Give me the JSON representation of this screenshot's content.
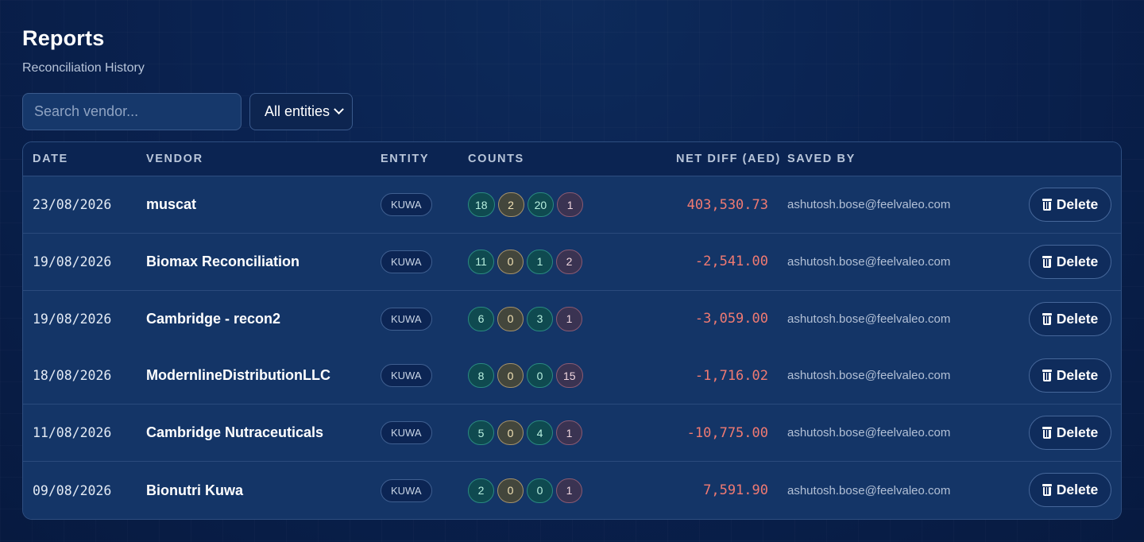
{
  "header": {
    "title": "Reports",
    "subtitle": "Reconciliation History"
  },
  "filters": {
    "search_placeholder": "Search vendor...",
    "entity_select_value": "All entities"
  },
  "table": {
    "columns": [
      "DATE",
      "VENDOR",
      "ENTITY",
      "COUNTS",
      "NET DIFF (AED)",
      "SAVED BY"
    ],
    "delete_label": "Delete",
    "rows": [
      {
        "date": "23/08/2026",
        "vendor": "muscat",
        "entity": "KUWA",
        "counts": [
          "18",
          "2",
          "20",
          "1"
        ],
        "net_diff": "403,530.73",
        "saved_by": "ashutosh.bose@feelvaleo.com"
      },
      {
        "date": "19/08/2026",
        "vendor": "Biomax Reconciliation",
        "entity": "KUWA",
        "counts": [
          "11",
          "0",
          "1",
          "2"
        ],
        "net_diff": "-2,541.00",
        "saved_by": "ashutosh.bose@feelvaleo.com"
      },
      {
        "date": "19/08/2026",
        "vendor": "Cambridge - recon2",
        "entity": "KUWA",
        "counts": [
          "6",
          "0",
          "3",
          "1"
        ],
        "net_diff": "-3,059.00",
        "saved_by": "ashutosh.bose@feelvaleo.com"
      },
      {
        "date": "18/08/2026",
        "vendor": "ModernlineDistributionLLC",
        "entity": "KUWA",
        "counts": [
          "8",
          "0",
          "0",
          "15"
        ],
        "net_diff": "-1,716.02",
        "saved_by": "ashutosh.bose@feelvaleo.com"
      },
      {
        "date": "11/08/2026",
        "vendor": "Cambridge Nutraceuticals",
        "entity": "KUWA",
        "counts": [
          "5",
          "0",
          "4",
          "1"
        ],
        "net_diff": "-10,775.00",
        "saved_by": "ashutosh.bose@feelvaleo.com"
      },
      {
        "date": "09/08/2026",
        "vendor": "Bionutri Kuwa",
        "entity": "KUWA",
        "counts": [
          "2",
          "0",
          "0",
          "1"
        ],
        "net_diff": "7,591.90",
        "saved_by": "ashutosh.bose@feelvaleo.com"
      }
    ]
  },
  "icons": {
    "delete": "trash-icon",
    "select": "chevron-down-icon"
  },
  "colors": {
    "background": "#0a1f44",
    "net_diff_text": "#f07a72",
    "count_matched": "#2a8a80",
    "count_warning": "#a5926a",
    "count_error": "#8a5a72"
  }
}
